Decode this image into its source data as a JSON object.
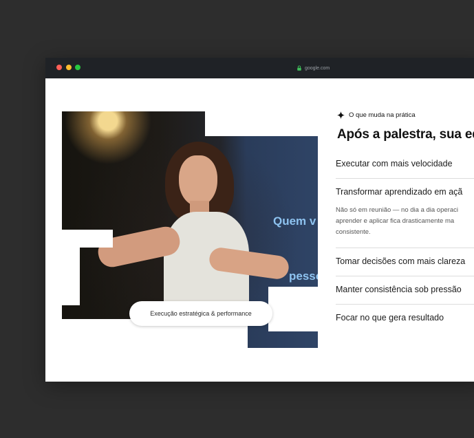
{
  "browser": {
    "url": "google.com",
    "colors": {
      "close": "#ff5f57",
      "minimize": "#febc2e",
      "maximize": "#28c840"
    }
  },
  "hero_image": {
    "screen_text_1": "Quem v",
    "screen_text_2": "pesso",
    "caption": "Execução estratégica & performance"
  },
  "section": {
    "eyebrow": "O que muda na prática",
    "title": "Após a palestra, sua eq",
    "items": [
      {
        "label": "Executar com mais velocidade"
      },
      {
        "label": "Transformar aprendizado em açã",
        "description_lines": [
          "Não só em reunião — no dia a dia operaci",
          "aprender e aplicar fica drasticamente ma",
          "consistente."
        ]
      },
      {
        "label": "Tomar decisões com mais clareza"
      },
      {
        "label": "Manter consistência sob pressão"
      },
      {
        "label": "Focar no que gera resultado"
      }
    ]
  }
}
